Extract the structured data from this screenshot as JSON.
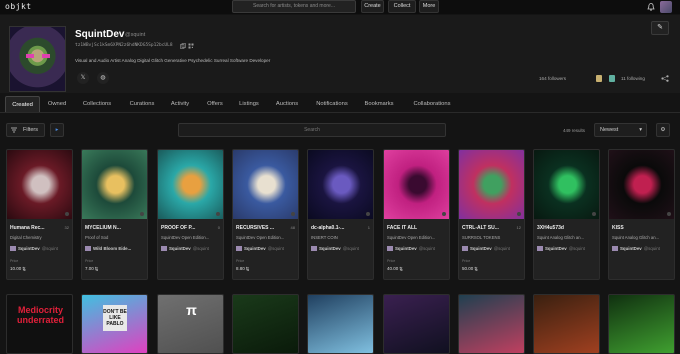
{
  "topbar": {
    "logo": "objkt",
    "search_placeholder": "Search for artists, tokens and more...",
    "create": "Create",
    "collect": "Collect",
    "more": "More"
  },
  "profile": {
    "name": "SquintDev",
    "handle": "@squint",
    "address": "tz1WBvjSc1kSm6XPN2z6hdNKDG5Sp12bcUL8",
    "bio": "Visual and Audio Artist Analog Digital Glitch Generative Psychedelic Surreal Software Developer",
    "followers_label": "164 followers",
    "following_label": "11 following"
  },
  "tabs": [
    "Created",
    "Owned",
    "Collections",
    "Curations",
    "Activity",
    "Offers",
    "Listings",
    "Auctions",
    "Notifications",
    "Bookmarks",
    "Collaborations"
  ],
  "filters": {
    "filters_label": "Filters",
    "search_placeholder": "Search",
    "results": "449 results",
    "sort": "Newest"
  },
  "cards": [
    {
      "title": "Humana Rec...",
      "edition": "32",
      "subtitle": "Digital Chemistry",
      "creator": "SquintDev",
      "creator_handle": "@squint",
      "price_label": "Price",
      "price": "10.00 ꜩ",
      "colors": [
        "#6a1a26",
        "#d0c0c0",
        "#2a0a10"
      ]
    },
    {
      "title": "MYCELIUM N...",
      "edition": "",
      "subtitle": "Proof of Sod",
      "creator": "",
      "creator_extra": "Wild Bloom Eide...",
      "price_label": "Price",
      "price": "7.00 ꜩ",
      "colors": [
        "#1d4a3a",
        "#e8c060",
        "#3a7a5a"
      ]
    },
    {
      "title": "PROOF OF P...",
      "edition": "0",
      "subtitle": "SquintDev Open Edition...",
      "creator": "SquintDev",
      "creator_handle": "@squint",
      "price_label": "",
      "price": "",
      "colors": [
        "#2aa8a8",
        "#e8a040",
        "#1a5a5a"
      ]
    },
    {
      "title": "RECURSIVES ...",
      "edition": "48",
      "subtitle": "SquintDev Open Edition...",
      "creator": "SquintDev",
      "creator_handle": "@squint",
      "price_label": "Price",
      "price": "8.80 ꜩ",
      "colors": [
        "#3a5aa0",
        "#e8e0d0",
        "#2a3a6a"
      ]
    },
    {
      "title": "dc-alpha0.1-...",
      "edition": "1",
      "subtitle": "INSERT COIN",
      "creator": "SquintDev",
      "creator_handle": "@squint",
      "price_label": "",
      "price": "",
      "colors": [
        "#1a1440",
        "#6a5ac0",
        "#0a0a20"
      ]
    },
    {
      "title": "FACE IT ALL",
      "edition": "",
      "subtitle": "SquintDev Open Edition...",
      "creator": "SquintDev",
      "creator_handle": "@squint",
      "price_label": "Price",
      "price": "40.00 ꜩ",
      "colors": [
        "#c02080",
        "#3a0a30",
        "#e040a0"
      ]
    },
    {
      "title": "CTRL-ALT SU...",
      "edition": "12",
      "subtitle": "SURRSOL TOKENS",
      "creator": "SquintDev",
      "creator_handle": "@squint",
      "price_label": "Price",
      "price": "50.00 ꜩ",
      "colors": [
        "#c03060",
        "#40a060",
        "#8030a0"
      ]
    },
    {
      "title": "3XH4u573d",
      "edition": "",
      "subtitle": "Squint Analog Glitch an...",
      "creator": "SquintDev",
      "creator_handle": "@squint",
      "price_label": "",
      "price": "",
      "colors": [
        "#0a3020",
        "#30c060",
        "#081810"
      ]
    },
    {
      "title": "KISS",
      "edition": "",
      "subtitle": "Squint Analog Glitch an...",
      "creator": "SquintDev",
      "creator_handle": "@squint",
      "price_label": "",
      "price": "",
      "colors": [
        "#0a0a0a",
        "#c02050",
        "#201018"
      ]
    }
  ],
  "row2": [
    {
      "label": "Mediocrity underrated",
      "colors": [
        "#101010",
        "#101010"
      ]
    },
    {
      "label": "DON'T BE LIKE PABLO",
      "colors": [
        "#40c0e0",
        "#e040c0"
      ]
    },
    {
      "label": "π",
      "colors": [
        "#707070",
        "#505050"
      ]
    },
    {
      "label": "",
      "colors": [
        "#1a3a1a",
        "#0a1a0a"
      ]
    },
    {
      "label": "",
      "colors": [
        "#204060",
        "#80c0e0"
      ]
    },
    {
      "label": "",
      "colors": [
        "#3a2050",
        "#101020"
      ]
    },
    {
      "label": "",
      "colors": [
        "#204050",
        "#c04060"
      ]
    },
    {
      "label": "",
      "colors": [
        "#3a2010",
        "#a04020"
      ]
    },
    {
      "label": "",
      "colors": [
        "#103010",
        "#40a030"
      ]
    }
  ]
}
